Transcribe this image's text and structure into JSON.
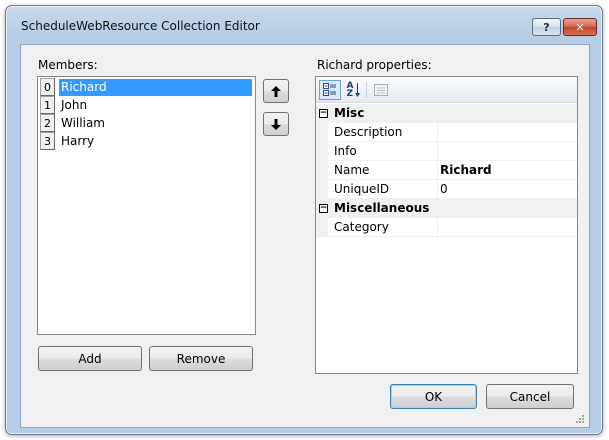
{
  "window": {
    "title": "ScheduleWebResource Collection Editor",
    "help_label": "?",
    "close_label": "✕"
  },
  "members": {
    "label": "Members:",
    "items": [
      {
        "index": "0",
        "name": "Richard",
        "selected": true
      },
      {
        "index": "1",
        "name": "John"
      },
      {
        "index": "2",
        "name": "William"
      },
      {
        "index": "3",
        "name": "Harry"
      }
    ],
    "move_up_icon": "↑",
    "move_down_icon": "↓",
    "add_label": "Add",
    "remove_label": "Remove"
  },
  "properties": {
    "label": "Richard properties:",
    "toolbar": {
      "alphabetical_label": "A Z"
    },
    "categories": [
      {
        "name": "Misc",
        "expander": "−",
        "rows": [
          {
            "name": "Description",
            "value": ""
          },
          {
            "name": "Info",
            "value": ""
          },
          {
            "name": "Name",
            "value": "Richard"
          },
          {
            "name": "UniqueID",
            "value": "0"
          }
        ]
      },
      {
        "name": "Miscellaneous",
        "expander": "−",
        "rows": [
          {
            "name": "Category",
            "value": ""
          }
        ]
      }
    ]
  },
  "footer": {
    "ok_label": "OK",
    "cancel_label": "Cancel"
  },
  "colors": {
    "selection": "#3399ff",
    "window_frame": "#b7cde6",
    "close_button": "#c4432b"
  }
}
